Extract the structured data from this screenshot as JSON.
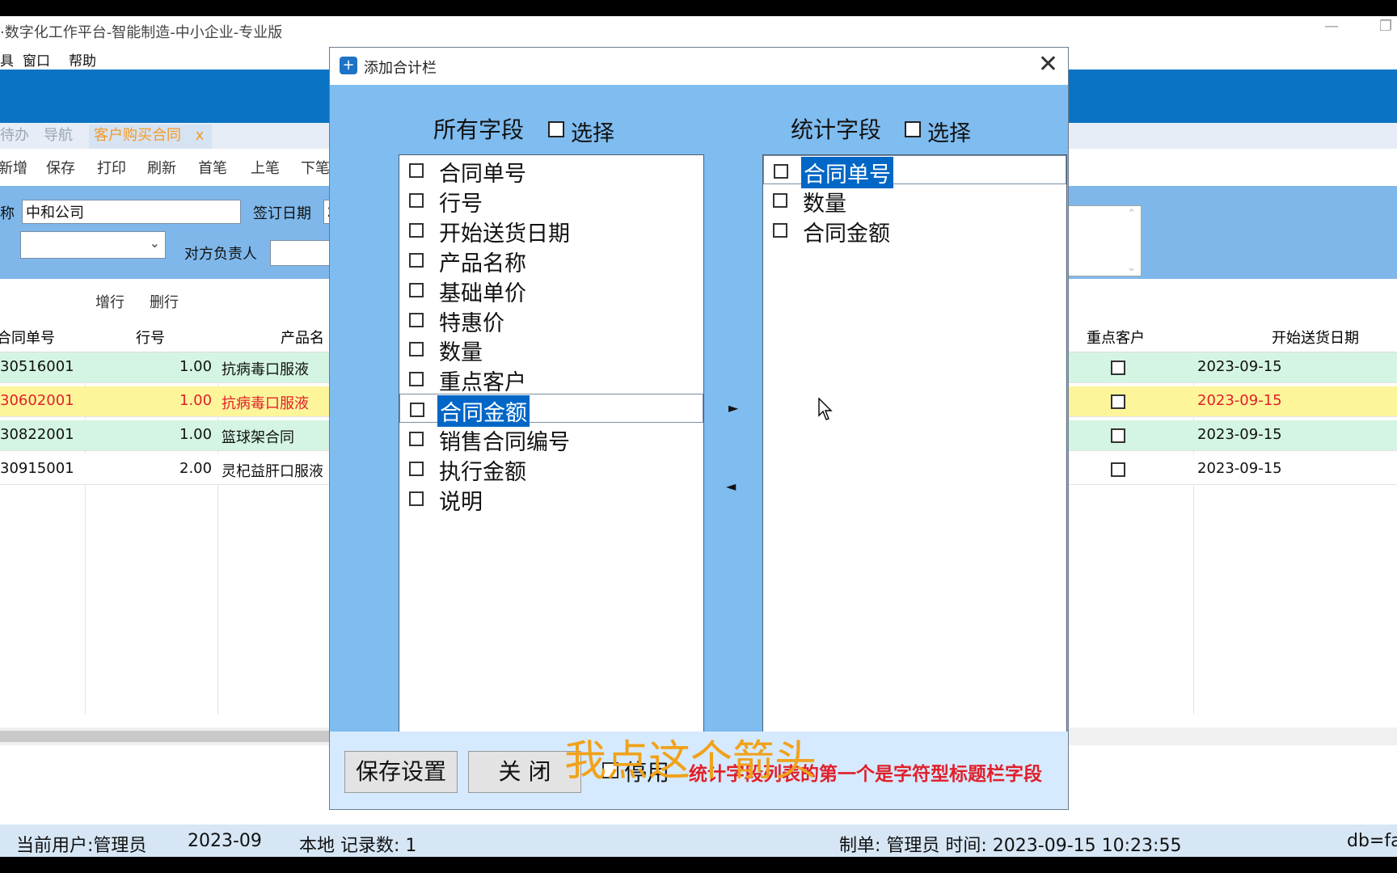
{
  "window": {
    "title": "·数字化工作平台-智能制造-中小企业-专业版",
    "minimize_glyph": "—",
    "restore_glyph": "❐"
  },
  "menu": [
    "具",
    "窗口",
    "帮助"
  ],
  "tabs": [
    "待办",
    "导航",
    "客户购买合同",
    "x"
  ],
  "toolbar": [
    "新增",
    "保存",
    "打印",
    "刷新",
    "首笔",
    "上笔",
    "下笔"
  ],
  "form": {
    "name_label": "称",
    "name_value": "中和公司",
    "sign_date_label": "签订日期",
    "sign_date_value": "2",
    "contact_label": "对方负责人"
  },
  "row_actions": [
    "增行",
    "删行"
  ],
  "grid": {
    "headers": {
      "contract_no": "合同单号",
      "line_no": "行号",
      "product": "产品名",
      "key_customer": "重点客户",
      "start_date": "开始送货日期"
    },
    "rows": [
      {
        "contract_no": "30516001",
        "line_no": "1.00",
        "product": "抗病毒口服液",
        "key_customer": false,
        "start_date": "2023-09-15",
        "style": "green"
      },
      {
        "contract_no": "30602001",
        "line_no": "1.00",
        "product": "抗病毒口服液",
        "key_customer": false,
        "start_date": "2023-09-15",
        "style": "yellow"
      },
      {
        "contract_no": "30822001",
        "line_no": "1.00",
        "product": "篮球架合同",
        "key_customer": false,
        "start_date": "2023-09-15",
        "style": "green"
      },
      {
        "contract_no": "30915001",
        "line_no": "2.00",
        "product": "灵杞益肝口服液",
        "key_customer": false,
        "start_date": "2023-09-15",
        "style": "white"
      }
    ]
  },
  "status": {
    "user": "当前用户:管理员",
    "period": "2023-09",
    "records": "本地 记录数: 1",
    "maker": "制单: 管理员 时间: 2023-09-15 10:23:55",
    "db": "db=fa"
  },
  "dialog": {
    "title": "添加合计栏",
    "close_glyph": "✕",
    "all_fields_header": "所有字段",
    "stat_fields_header": "统计字段",
    "select_label": "选择",
    "all_fields": [
      "合同单号",
      "行号",
      "开始送货日期",
      "产品名称",
      "基础单价",
      "特惠价",
      "数量",
      "重点客户",
      "合同金额",
      "销售合同编号",
      "执行金额",
      "说明"
    ],
    "all_fields_selected_index": 8,
    "stat_fields": [
      "合同单号",
      "数量",
      "合同金额"
    ],
    "stat_fields_selected_index": 0,
    "move_right_glyph": "►",
    "move_left_glyph": "◄",
    "save_button": "保存设置",
    "close_button": "关 闭",
    "disable_label": "停用",
    "note": "统计字段列表的第一个是字符型标题栏字段",
    "caption": "我点这个箭头"
  },
  "colors": {
    "accent_blue": "#0a73c3",
    "dialog_bg": "#7fbcf0",
    "selection": "#0067c7",
    "row_green": "#d4f5e3",
    "row_yellow": "#fdf59a",
    "note_red": "#e0202a",
    "caption_orange": "#f0a21a"
  }
}
